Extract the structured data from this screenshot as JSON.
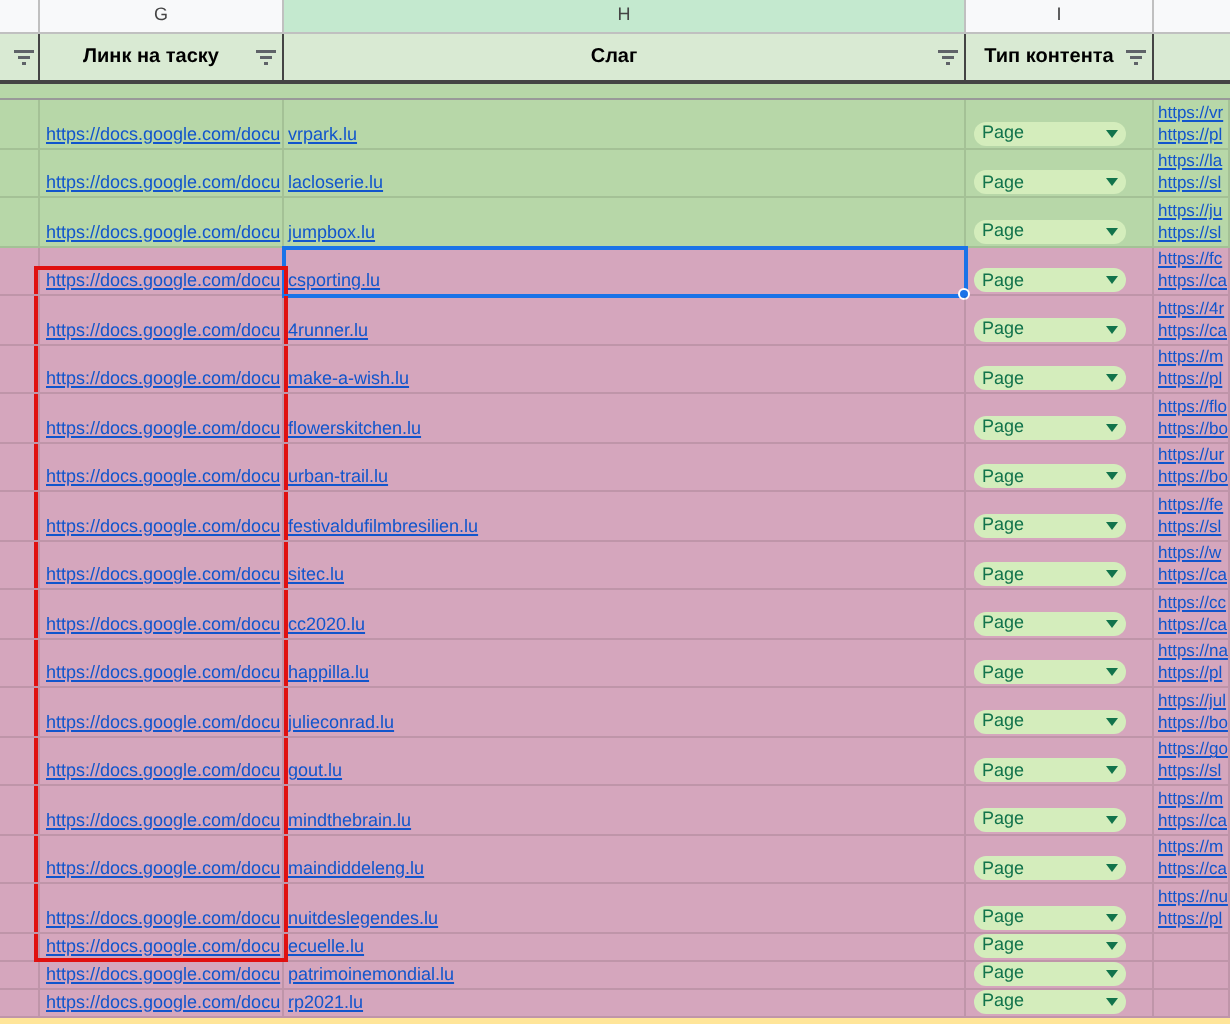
{
  "column_letters": [
    {
      "letter": "G",
      "selected": false
    },
    {
      "letter": "H",
      "selected": true
    },
    {
      "letter": "I",
      "selected": false
    }
  ],
  "headers": [
    "Линк на таску",
    "Слаг",
    "Тип контента"
  ],
  "rows": [
    {
      "color": "#b7d7a8",
      "task_link": "https://docs.google.com/docu",
      "slug": "vrpark.lu",
      "content_type": "Page",
      "links": [
        "https://vr",
        "https://pl"
      ],
      "selected": false,
      "highlighted": false
    },
    {
      "color": "#b7d7a8",
      "task_link": "https://docs.google.com/docu",
      "slug": "lacloserie.lu",
      "content_type": "Page",
      "links": [
        "https://la",
        "https://sl"
      ],
      "selected": false,
      "highlighted": false
    },
    {
      "color": "#b7d7a8",
      "task_link": "https://docs.google.com/docu",
      "slug": "jumpbox.lu",
      "content_type": "Page",
      "links": [
        "https://ju",
        "https://sl"
      ],
      "selected": false,
      "highlighted": false
    },
    {
      "color": "#d5a6bd",
      "task_link": "https://docs.google.com/docu",
      "slug": "csporting.lu",
      "content_type": "Page",
      "links": [
        "https://fc",
        "https://ca"
      ],
      "selected": true,
      "highlighted": true
    },
    {
      "color": "#d5a6bd",
      "task_link": "https://docs.google.com/docu",
      "slug": "4runner.lu",
      "content_type": "Page",
      "links": [
        "https://4r",
        "https://ca"
      ],
      "selected": false,
      "highlighted": true
    },
    {
      "color": "#d5a6bd",
      "task_link": "https://docs.google.com/docu",
      "slug": "make-a-wish.lu",
      "content_type": "Page",
      "links": [
        "https://m",
        "https://pl"
      ],
      "selected": false,
      "highlighted": true
    },
    {
      "color": "#d5a6bd",
      "task_link": "https://docs.google.com/docu",
      "slug": "flowerskitchen.lu",
      "content_type": "Page",
      "links": [
        "https://flo",
        "https://bo"
      ],
      "selected": false,
      "highlighted": true
    },
    {
      "color": "#d5a6bd",
      "task_link": "https://docs.google.com/docu",
      "slug": "urban-trail.lu",
      "content_type": "Page",
      "links": [
        "https://ur",
        "https://bo"
      ],
      "selected": false,
      "highlighted": true
    },
    {
      "color": "#d5a6bd",
      "task_link": "https://docs.google.com/docu",
      "slug": "festivaldufilmbresilien.lu",
      "content_type": "Page",
      "links": [
        "https://fe",
        "https://sl"
      ],
      "selected": false,
      "highlighted": true
    },
    {
      "color": "#d5a6bd",
      "task_link": "https://docs.google.com/docu",
      "slug": "sitec.lu",
      "content_type": "Page",
      "links": [
        "https://w",
        "https://ca"
      ],
      "selected": false,
      "highlighted": true
    },
    {
      "color": "#d5a6bd",
      "task_link": "https://docs.google.com/docu",
      "slug": "cc2020.lu",
      "content_type": "Page",
      "links": [
        "https://cc",
        "https://ca"
      ],
      "selected": false,
      "highlighted": true
    },
    {
      "color": "#d5a6bd",
      "task_link": "https://docs.google.com/docu",
      "slug": "happilla.lu",
      "content_type": "Page",
      "links": [
        "https://na",
        "https://pl"
      ],
      "selected": false,
      "highlighted": true
    },
    {
      "color": "#d5a6bd",
      "task_link": "https://docs.google.com/docu",
      "slug": "julieconrad.lu",
      "content_type": "Page",
      "links": [
        "https://jul",
        "https://bo"
      ],
      "selected": false,
      "highlighted": true
    },
    {
      "color": "#d5a6bd",
      "task_link": "https://docs.google.com/docu",
      "slug": "gout.lu",
      "content_type": "Page",
      "links": [
        "https://go",
        "https://sl"
      ],
      "selected": false,
      "highlighted": true
    },
    {
      "color": "#d5a6bd",
      "task_link": "https://docs.google.com/docu",
      "slug": "mindthebrain.lu",
      "content_type": "Page",
      "links": [
        "https://m",
        "https://ca"
      ],
      "selected": false,
      "highlighted": true
    },
    {
      "color": "#d5a6bd",
      "task_link": "https://docs.google.com/docu",
      "slug": "maindiddeleng.lu",
      "content_type": "Page",
      "links": [
        "https://m",
        "https://ca"
      ],
      "selected": false,
      "highlighted": true
    },
    {
      "color": "#d5a6bd",
      "task_link": "https://docs.google.com/docu",
      "slug": "nuitdeslegendes.lu",
      "content_type": "Page",
      "links": [
        "https://nu",
        "https://pl"
      ],
      "selected": false,
      "highlighted": true
    },
    {
      "color": "#d5a6bd",
      "task_link": "https://docs.google.com/docu",
      "slug": "ecuelle.lu",
      "content_type": "Page",
      "links": [],
      "selected": false,
      "highlighted": true
    },
    {
      "color": "#d5a6bd",
      "task_link": "https://docs.google.com/docu",
      "slug": "patrimoinemondial.lu",
      "content_type": "Page",
      "links": [],
      "selected": false,
      "highlighted": false
    },
    {
      "color": "#d5a6bd",
      "task_link": "https://docs.google.com/docu",
      "slug": "rp2021.lu",
      "content_type": "Page",
      "links": [],
      "selected": false,
      "highlighted": false
    }
  ]
}
